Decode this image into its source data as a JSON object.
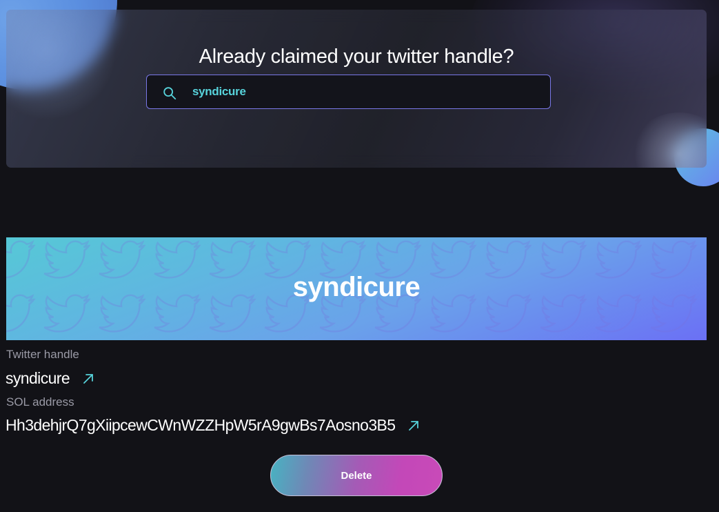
{
  "search": {
    "title": "Already claimed your twitter handle?",
    "value": "syndicure",
    "icon": "search-icon"
  },
  "banner": {
    "title": "syndicure",
    "pattern_icon": "twitter-bird-icon"
  },
  "profile": {
    "handle_label": "Twitter handle",
    "handle_value": "syndicure",
    "sol_label": "SOL address",
    "sol_value": "Hh3dehjrQ7gXiipcewCWnWZZHpW5rA9gwBs7Aosno3B5",
    "link_icon": "external-link-icon"
  },
  "actions": {
    "delete_label": "Delete"
  },
  "colors": {
    "accent": "#57d3db",
    "border": "#7a78e8",
    "background": "#121217"
  }
}
